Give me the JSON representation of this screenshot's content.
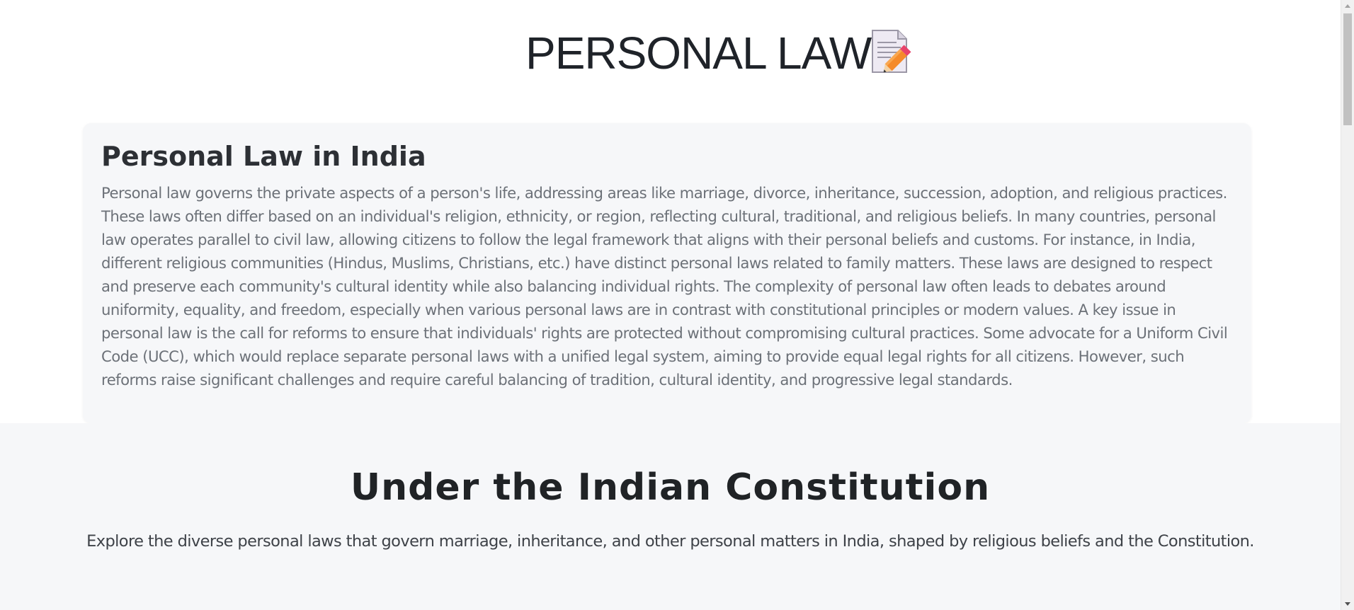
{
  "header": {
    "title": "PERSONAL LAW",
    "icon": "memo-icon"
  },
  "intro": {
    "heading": "Personal Law in India",
    "body": "Personal law governs the private aspects of a person's life, addressing areas like marriage, divorce, inheritance, succession, adoption, and religious practices. These laws often differ based on an individual's religion, ethnicity, or region, reflecting cultural, traditional, and religious beliefs. In many countries, personal law operates parallel to civil law, allowing citizens to follow the legal framework that aligns with their personal beliefs and customs. For instance, in India, different religious communities (Hindus, Muslims, Christians, etc.) have distinct personal laws related to family matters. These laws are designed to respect and preserve each community's cultural identity while also balancing individual rights. The complexity of personal law often leads to debates around uniformity, equality, and freedom, especially when various personal laws are in contrast with constitutional principles or modern values. A key issue in personal law is the call for reforms to ensure that individuals' rights are protected without compromising cultural practices. Some advocate for a Uniform Civil Code (UCC), which would replace separate personal laws with a unified legal system, aiming to provide equal legal rights for all citizens. However, such reforms raise significant challenges and require careful balancing of tradition, cultural identity, and progressive legal standards."
  },
  "constitution_section": {
    "heading": "Under the Indian Constitution",
    "subheading": "Explore the diverse personal laws that govern marriage, inheritance, and other personal matters in India, shaped by religious beliefs and the Constitution."
  },
  "colors": {
    "card_background": "#f6f7f9",
    "title_text": "#1f2329",
    "body_text": "#6c7178",
    "memo_pencil": "#f58a2a",
    "memo_eraser": "#e8436b"
  }
}
